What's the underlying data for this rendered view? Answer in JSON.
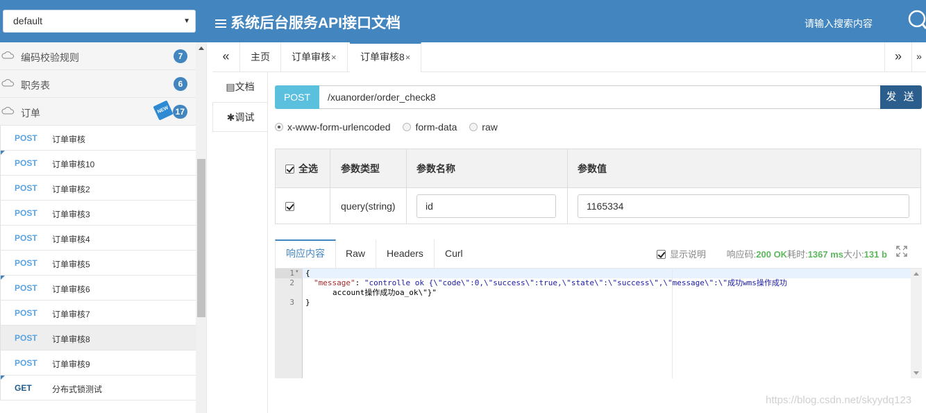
{
  "header": {
    "group_select": "default",
    "title": "系统后台服务API接口文档",
    "search_placeholder": "请输入搜索内容",
    "bg_color": "#4285bf"
  },
  "sidebar": {
    "groups": [
      {
        "label": "编码校验规则",
        "count": "7"
      },
      {
        "label": "职务表",
        "count": "6"
      },
      {
        "label": "订单",
        "count": "17",
        "new_tag": "NEW"
      }
    ],
    "items": [
      {
        "method": "POST",
        "name": "订单审核"
      },
      {
        "method": "POST",
        "name": "订单审核10"
      },
      {
        "method": "POST",
        "name": "订单审核2"
      },
      {
        "method": "POST",
        "name": "订单审核3"
      },
      {
        "method": "POST",
        "name": "订单审核4"
      },
      {
        "method": "POST",
        "name": "订单审核5"
      },
      {
        "method": "POST",
        "name": "订单审核6"
      },
      {
        "method": "POST",
        "name": "订单审核7"
      },
      {
        "method": "POST",
        "name": "订单审核8"
      },
      {
        "method": "POST",
        "name": "订单审核9"
      },
      {
        "method": "GET",
        "name": "分布式锁测试"
      }
    ]
  },
  "tabs": {
    "prev": "«",
    "next": "»",
    "items": [
      {
        "label": "主页",
        "close": ""
      },
      {
        "label": "订单审核",
        "close": "×"
      },
      {
        "label": "订单审核8",
        "close": "×"
      }
    ]
  },
  "side_tabs": {
    "doc": "文档",
    "debug": "调试"
  },
  "request": {
    "method": "POST",
    "url": "/xuanorder/order_check8",
    "send": "发 送"
  },
  "content_types": [
    "x-www-form-urlencoded",
    "form-data",
    "raw"
  ],
  "params": {
    "headers": {
      "select_all": "全选",
      "type": "参数类型",
      "name": "参数名称",
      "value": "参数值"
    },
    "rows": [
      {
        "type": "query(string)",
        "name": "id",
        "value": "1165334"
      }
    ]
  },
  "response": {
    "tabs": [
      "响应内容",
      "Raw",
      "Headers",
      "Curl"
    ],
    "show_desc": "显示说明",
    "code_label": "响应码:",
    "code_value": "200 OK",
    "time_label": "耗时:",
    "time_value": "1367 ms",
    "size_label": "大小:",
    "size_value": "131 b",
    "line_numbers": [
      "1",
      "2",
      "3"
    ],
    "code_lines": {
      "l1": "{",
      "l2_key": "\"message\"",
      "l2_colon": ": ",
      "l2_value": "\"controlle ok {\\\"code\\\":0,\\\"success\\\":true,\\\"state\\\":\\\"success\\\",\\\"message\\\":\\\"成功wms操作成功",
      "l2_cont": "account操作成功oa_ok\\\"}\"",
      "l3": "}"
    }
  },
  "watermark": "https://blog.csdn.net/skyydq123"
}
